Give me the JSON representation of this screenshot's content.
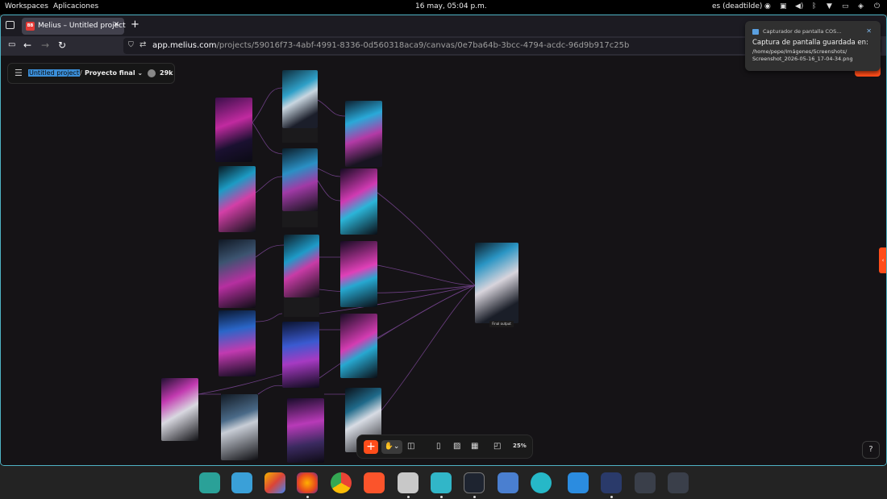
{
  "system_bar": {
    "workspaces": "Workspaces",
    "applications": "Aplicaciones",
    "clock": "16 may, 05:04 p.m.",
    "keyboard_layout": "es (deadtilde)"
  },
  "browser": {
    "tab_title": "Melius – Untitled project",
    "tab_favicon": "BB",
    "url_host": "app.melius.com",
    "url_path": "/projects/59016f73-4abf-4991-8336-0d560318aca9/canvas/0e7ba64b-3bcc-4794-acdc-96d9b917c25b"
  },
  "project": {
    "name": "Untitled project",
    "separator": "/",
    "folder": "Proyecto final",
    "credits": "29k"
  },
  "canvas": {
    "node_labels": [
      "Final output"
    ]
  },
  "toolbar": {
    "zoom": "25%"
  },
  "notification": {
    "app": "Capturador de pantalla COS...",
    "title": "Captura de pantalla guardada en:",
    "path_line1": "/home/pepe/Imágenes/Screenshots/",
    "path_line2": "Screenshot_2026-05-16_17-04-34.png"
  },
  "colors": {
    "accent": "#ff4d1a",
    "window_border": "#4fb3c5",
    "canvas_bg": "#151316",
    "link": "#a05cc8"
  },
  "icons": [
    "search-icon",
    "grid-icon",
    "firefox-icon",
    "chrome-icon",
    "brave-icon",
    "files-icon",
    "terminal-icon",
    "vscode-icon"
  ]
}
